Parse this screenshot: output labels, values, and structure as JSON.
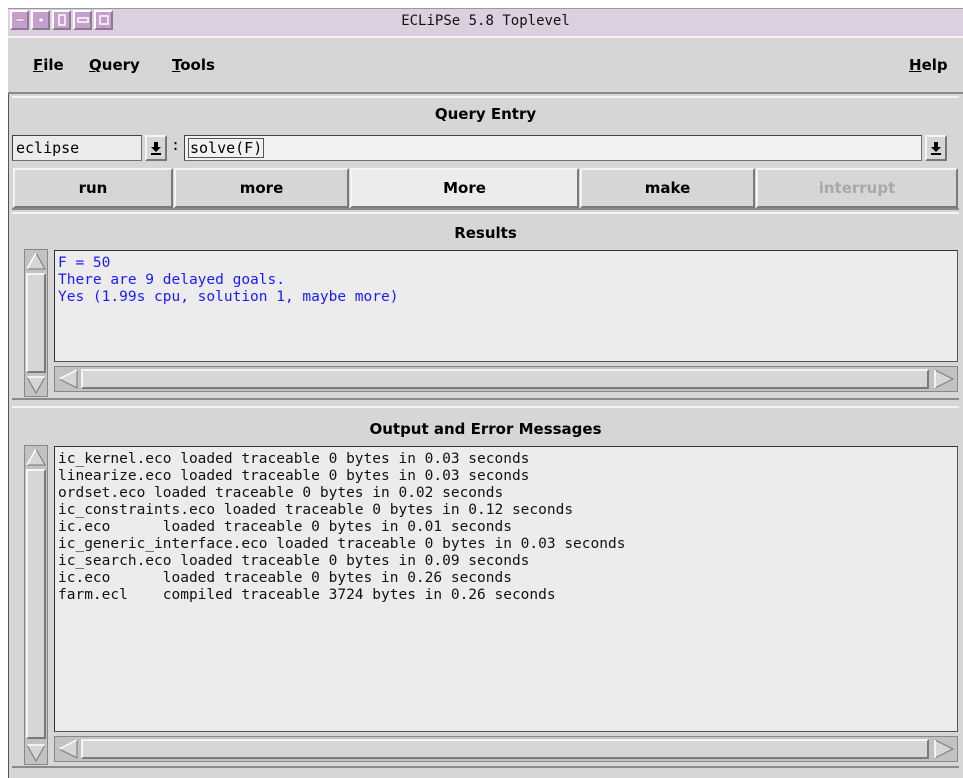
{
  "window": {
    "title": "ECLiPSe 5.8 Toplevel"
  },
  "menubar": {
    "file": {
      "underline": "F",
      "rest": "ile"
    },
    "query": {
      "underline": "Q",
      "rest": "uery"
    },
    "tools": {
      "underline": "T",
      "rest": "ools"
    },
    "help": {
      "underline": "H",
      "rest": "elp"
    }
  },
  "query_entry": {
    "section_title": "Query Entry",
    "module_value": "eclipse",
    "separator": ":",
    "query_value": "solve(F)",
    "buttons": {
      "run": "run",
      "more": "more",
      "More": "More",
      "make": "make",
      "interrupt": "interrupt"
    }
  },
  "results": {
    "section_title": "Results",
    "lines": [
      "F = 50",
      "There are 9 delayed goals.",
      "Yes (1.99s cpu, solution 1, maybe more)"
    ]
  },
  "output": {
    "section_title": "Output and Error Messages",
    "lines": [
      "ic_kernel.eco loaded traceable 0 bytes in 0.03 seconds",
      "linearize.eco loaded traceable 0 bytes in 0.03 seconds",
      "ordset.eco loaded traceable 0 bytes in 0.02 seconds",
      "ic_constraints.eco loaded traceable 0 bytes in 0.12 seconds",
      "ic.eco      loaded traceable 0 bytes in 0.01 seconds",
      "ic_generic_interface.eco loaded traceable 0 bytes in 0.03 seconds",
      "ic_search.eco loaded traceable 0 bytes in 0.09 seconds",
      "ic.eco      loaded traceable 0 bytes in 0.26 seconds",
      "farm.ecl    compiled traceable 3724 bytes in 0.26 seconds"
    ]
  },
  "colors": {
    "titlebar": "#dccfe0",
    "results_text": "#1a1aff",
    "window_bg": "#d6d6d6"
  }
}
